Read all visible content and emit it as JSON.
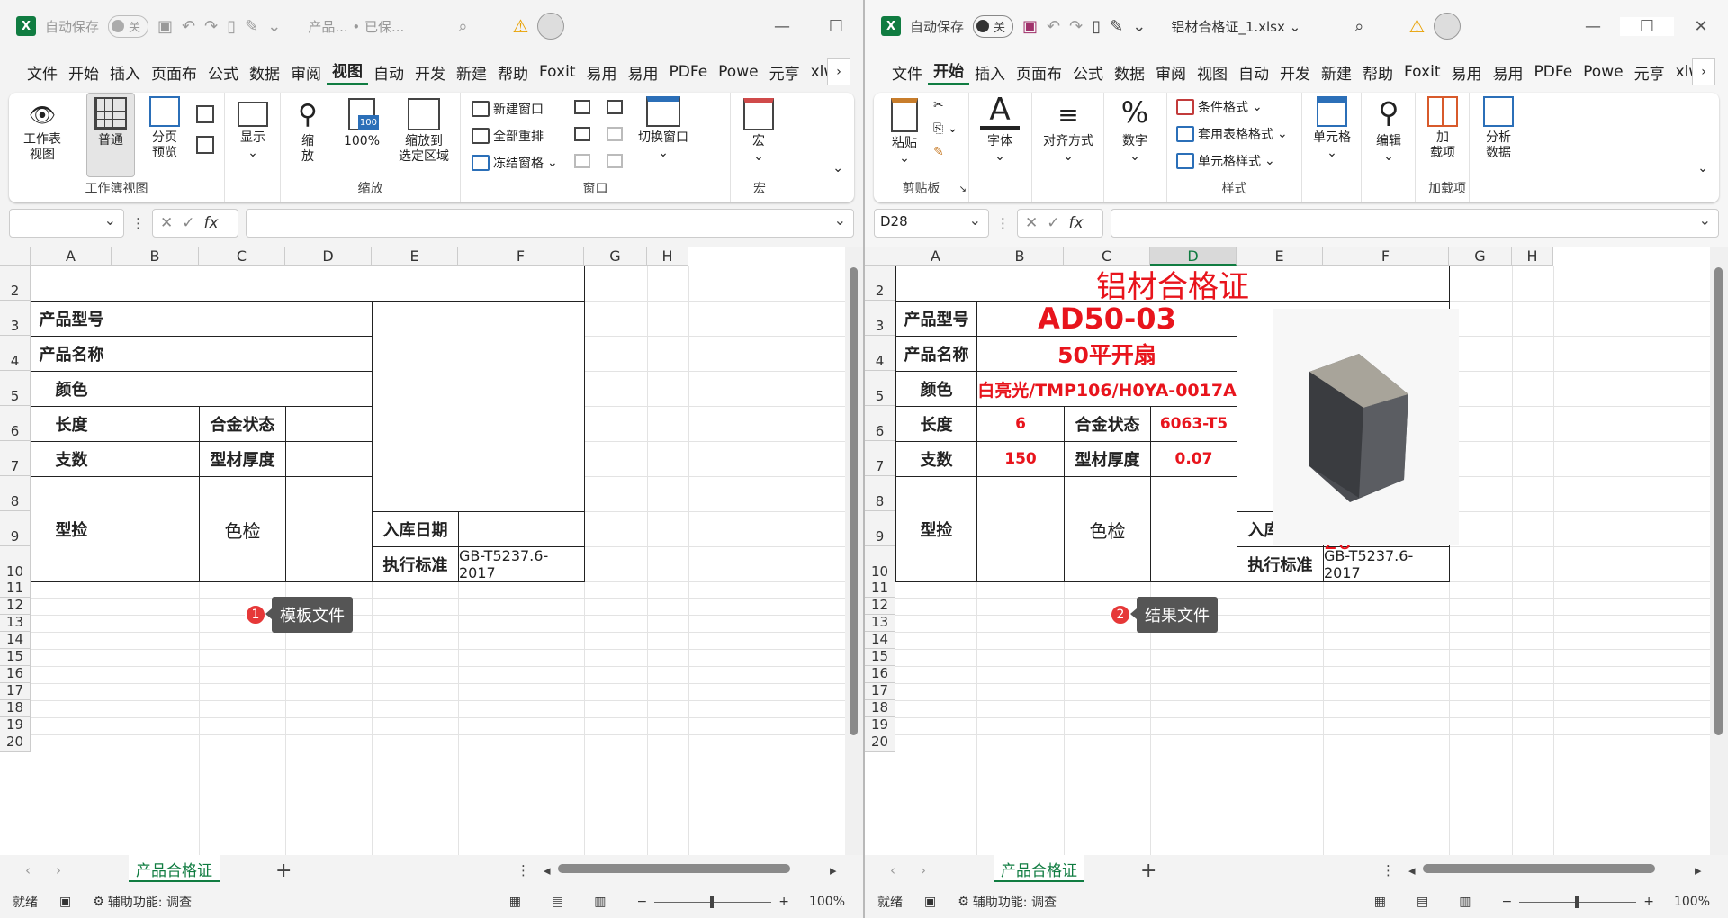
{
  "common": {
    "autosave_label": "自动保存",
    "autosave_state": "关",
    "menu": [
      "文件",
      "开始",
      "插入",
      "页面布",
      "公式",
      "数据",
      "审阅",
      "视图",
      "自动",
      "开发",
      "新建",
      "帮助",
      "Foxit",
      "易用",
      "易用",
      "PDFe",
      "Powe",
      "元亨",
      "xlwir"
    ],
    "columns": [
      "A",
      "B",
      "C",
      "D",
      "E",
      "F",
      "G",
      "H"
    ],
    "rows": [
      "2",
      "3",
      "4",
      "5",
      "6",
      "7",
      "8",
      "9",
      "10",
      "11",
      "12",
      "13",
      "14",
      "15",
      "16",
      "17",
      "18",
      "19",
      "20"
    ],
    "sheet_tab": "产品合格证",
    "status_ready": "就绪",
    "status_access": "辅助功能: 调查",
    "zoom": "100%",
    "labels": {
      "model": "产品型号",
      "name": "产品名称",
      "color": "颜色",
      "length": "长度",
      "alloy": "合金状态",
      "count": "支数",
      "thickness": "型材厚度",
      "type_check": "型捡",
      "color_check": "色检",
      "date": "入库日期",
      "standard": "执行标准"
    },
    "standard_value": "GB-T5237.6-2017"
  },
  "left": {
    "filename": "产品... • 已保...",
    "active_menu_index": 7,
    "ribbon": {
      "workbook_view": "工作表\n视图",
      "normal": "普通",
      "page_preview": "分页\n预览",
      "show": "显示",
      "zoom": "缩\n放",
      "zoom100": "100%",
      "zoom_sel": "缩放到\n选定区域",
      "new_window": "新建窗口",
      "arrange_all": "全部重排",
      "freeze": "冻结窗格",
      "switch_window": "切换窗口",
      "macro": "宏",
      "grp_workbook": "工作簿视图",
      "grp_zoom": "缩放",
      "grp_window": "窗口",
      "grp_macro": "宏"
    },
    "namebox": "",
    "callout_num": "1",
    "callout_text": "模板文件"
  },
  "right": {
    "filename": "铝材合格证_1.xlsx",
    "active_menu_index": 1,
    "ribbon": {
      "paste": "粘贴",
      "font": "字体",
      "align": "对齐方式",
      "number": "数字",
      "cond_fmt": "条件格式",
      "table_fmt": "套用表格格式",
      "cell_style": "单元格样式",
      "cells": "单元格",
      "edit": "编辑",
      "addins": "加\n载项",
      "analyze": "分析\n数据",
      "grp_clipboard": "剪贴板",
      "grp_style": "样式",
      "grp_addins": "加载项"
    },
    "namebox": "D28",
    "selected_col": "D",
    "title": "铝材合格证",
    "model_value": "AD50-03",
    "name_value": "50平开扇",
    "color_value": "白亮光/TMP106/H0YA-0017A",
    "length_value": "6",
    "alloy_value": "6063-T5",
    "count_value": "150",
    "thickness_value": "0.07",
    "date_value": "2025-03-26",
    "callout_num": "2",
    "callout_text": "结果文件"
  }
}
